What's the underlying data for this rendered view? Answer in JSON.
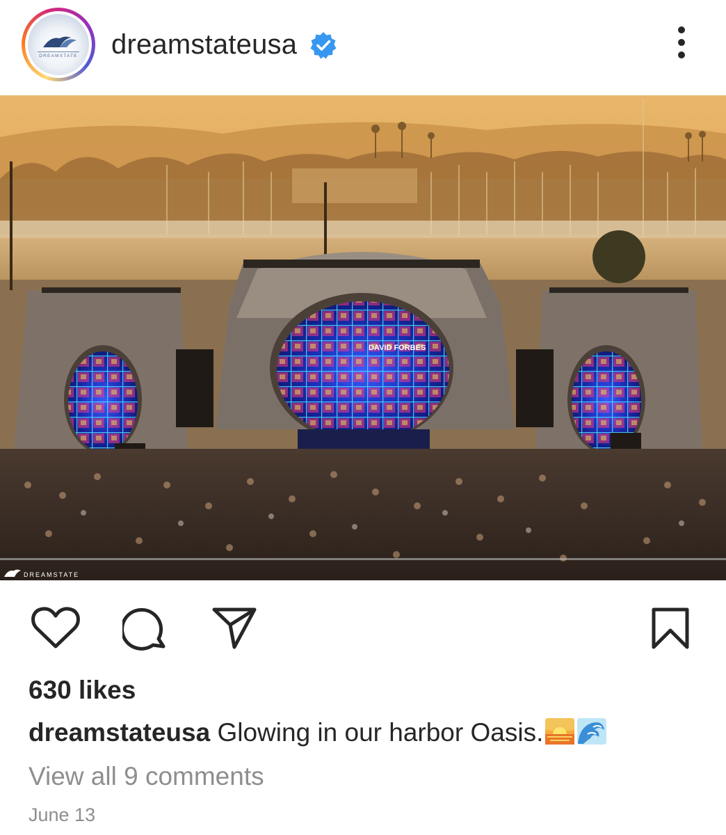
{
  "post": {
    "username": "dreamstateusa",
    "avatar_logo_text": "DREAMSTATE",
    "verified": true,
    "more_icon": "more-vertical-icon",
    "photo_watermark": "DREAMSTATE",
    "screen_text": "DAVID FORBES"
  },
  "actions": {
    "like_icon": "heart-icon",
    "comment_icon": "comment-icon",
    "share_icon": "share-icon",
    "save_icon": "bookmark-icon"
  },
  "stats": {
    "likes": "630 likes"
  },
  "caption": {
    "username": "dreamstateusa",
    "text": "Glowing in our harbor Oasis."
  },
  "comments": {
    "view_all": "View all 9 comments"
  },
  "meta": {
    "date": "June 13"
  },
  "colors": {
    "text": "#262626",
    "secondary": "#8e8e8e",
    "verified_blue": "#3897f0"
  }
}
